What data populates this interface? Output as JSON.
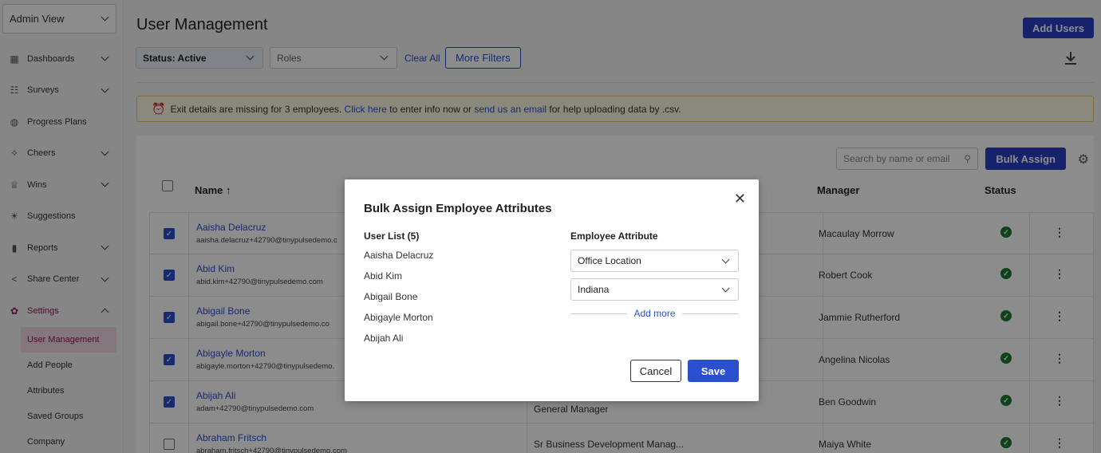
{
  "sidebar": {
    "view_select": "Admin View",
    "items": [
      {
        "label": "Dashboards",
        "icon": "dashboard-icon",
        "chevron": true
      },
      {
        "label": "Surveys",
        "icon": "survey-icon",
        "chevron": true
      },
      {
        "label": "Progress Plans",
        "icon": "progress-icon",
        "chevron": false
      },
      {
        "label": "Cheers",
        "icon": "cheers-icon",
        "chevron": true
      },
      {
        "label": "Wins",
        "icon": "trophy-icon",
        "chevron": true
      },
      {
        "label": "Suggestions",
        "icon": "lightbulb-icon",
        "chevron": false
      },
      {
        "label": "Reports",
        "icon": "bar-chart-icon",
        "chevron": true
      },
      {
        "label": "Share Center",
        "icon": "share-icon",
        "chevron": true
      },
      {
        "label": "Settings",
        "icon": "gear-icon",
        "chevron": true
      }
    ],
    "settings_sub": [
      "User Management",
      "Add People",
      "Attributes",
      "Saved Groups",
      "Company"
    ]
  },
  "header": {
    "title": "User Management",
    "add_users": "Add Users",
    "status_filter": "Status: Active",
    "roles_filter": "Roles",
    "clear_all": "Clear All",
    "more_filters": "More Filters"
  },
  "banner": {
    "text_before": "Exit details are missing for 3 employees.",
    "link1": "Click here",
    "text_mid": "to enter info now or",
    "link2": "send us an email",
    "text_after": "for help uploading data by .csv."
  },
  "table": {
    "search_placeholder": "Search by name or email",
    "bulk_assign": "Bulk Assign",
    "headers": {
      "name": "Name",
      "manager": "Manager",
      "status": "Status"
    },
    "rows": [
      {
        "name": "Aaisha Delacruz",
        "email": "aaisha.delacruz+42790@tinypulsedemo.c",
        "title": "",
        "manager": "Macaulay Morrow",
        "checked": true
      },
      {
        "name": "Abid Kim",
        "email": "abid.kim+42790@tinypulsedemo.com",
        "title": "",
        "manager": "Robert Cook",
        "checked": true
      },
      {
        "name": "Abigail Bone",
        "email": "abigail.bone+42790@tinypulsedemo.co",
        "title": "",
        "manager": "Jammie Rutherford",
        "checked": true
      },
      {
        "name": "Abigayle Morton",
        "email": "abigayle.morton+42790@tinypulsedemo.",
        "title": "",
        "manager": "Angelina Nicolas",
        "checked": true
      },
      {
        "name": "Abijah Ali",
        "email": "adam+42790@tinypulsedemo.com",
        "title": "General Manager",
        "manager": "Ben Goodwin",
        "checked": true
      },
      {
        "name": "Abraham Fritsch",
        "email": "abraham.fritsch+42790@tinypulsedemo.com",
        "title": "Sr Business Development Manag...",
        "manager": "Maiya White",
        "checked": false
      }
    ]
  },
  "modal": {
    "title": "Bulk Assign Employee Attributes",
    "user_list_heading": "User List (5)",
    "users": [
      "Aaisha Delacruz",
      "Abid Kim",
      "Abigail Bone",
      "Abigayle Morton",
      "Abijah Ali"
    ],
    "attr_heading": "Employee Attribute",
    "attribute": "Office Location",
    "value": "Indiana",
    "add_more": "Add more",
    "cancel": "Cancel",
    "save": "Save"
  }
}
